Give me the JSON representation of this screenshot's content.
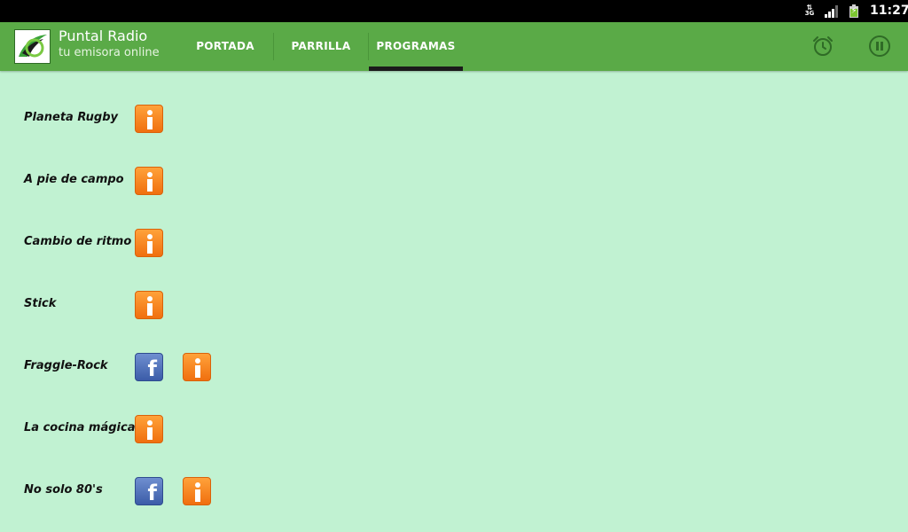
{
  "status_bar": {
    "network": "3G",
    "time": "11:27",
    "icons": [
      "data-transfer-icon",
      "signal-icon",
      "battery-charging-icon"
    ]
  },
  "app": {
    "title": "Puntal Radio",
    "subtitle": "tu emisora online",
    "logo_icon": "puntal-radio-logo"
  },
  "tabs": [
    {
      "label": "PORTADA",
      "selected": false
    },
    {
      "label": "PARRILLA",
      "selected": false
    },
    {
      "label": "PROGRAMAS",
      "selected": true
    }
  ],
  "actions": [
    {
      "icon": "alarm-clock-icon"
    },
    {
      "icon": "pause-icon"
    }
  ],
  "programs": [
    {
      "name": "Planeta Rugby",
      "facebook": false,
      "info": true
    },
    {
      "name": "A pie de campo",
      "facebook": false,
      "info": true
    },
    {
      "name": "Cambio de ritmo",
      "facebook": false,
      "info": true
    },
    {
      "name": "Stick",
      "facebook": false,
      "info": true
    },
    {
      "name": "Fraggle-Rock",
      "facebook": true,
      "info": true
    },
    {
      "name": "La cocina mágica",
      "facebook": false,
      "info": true
    },
    {
      "name": "No solo 80's",
      "facebook": true,
      "info": true
    }
  ],
  "colors": {
    "action_bar": "#5aaa47",
    "background": "#c1f2d2",
    "info_button": "#f58220",
    "facebook_button": "#3b5ca8"
  }
}
